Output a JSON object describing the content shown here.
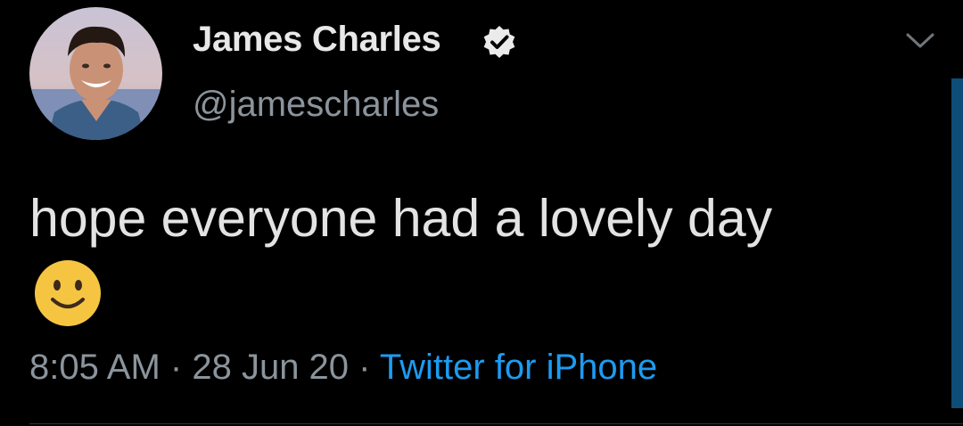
{
  "author": {
    "display_name": "James Charles",
    "handle": "@jamescharles",
    "verified": true
  },
  "tweet": {
    "text": "hope everyone had a lovely day",
    "emoji": "🙂",
    "time": "8:05 AM",
    "date": "28 Jun 20",
    "separator": "·",
    "source": "Twitter for iPhone"
  },
  "icons": {
    "verified": "verified-badge-icon",
    "menu": "chevron-down-icon",
    "emoji": "slightly-smiling-face-icon"
  },
  "colors": {
    "background": "#000000",
    "text": "#e3e3e3",
    "muted": "#8b949c",
    "link": "#1d9bf0",
    "scrollbar": "#0d4d78"
  }
}
